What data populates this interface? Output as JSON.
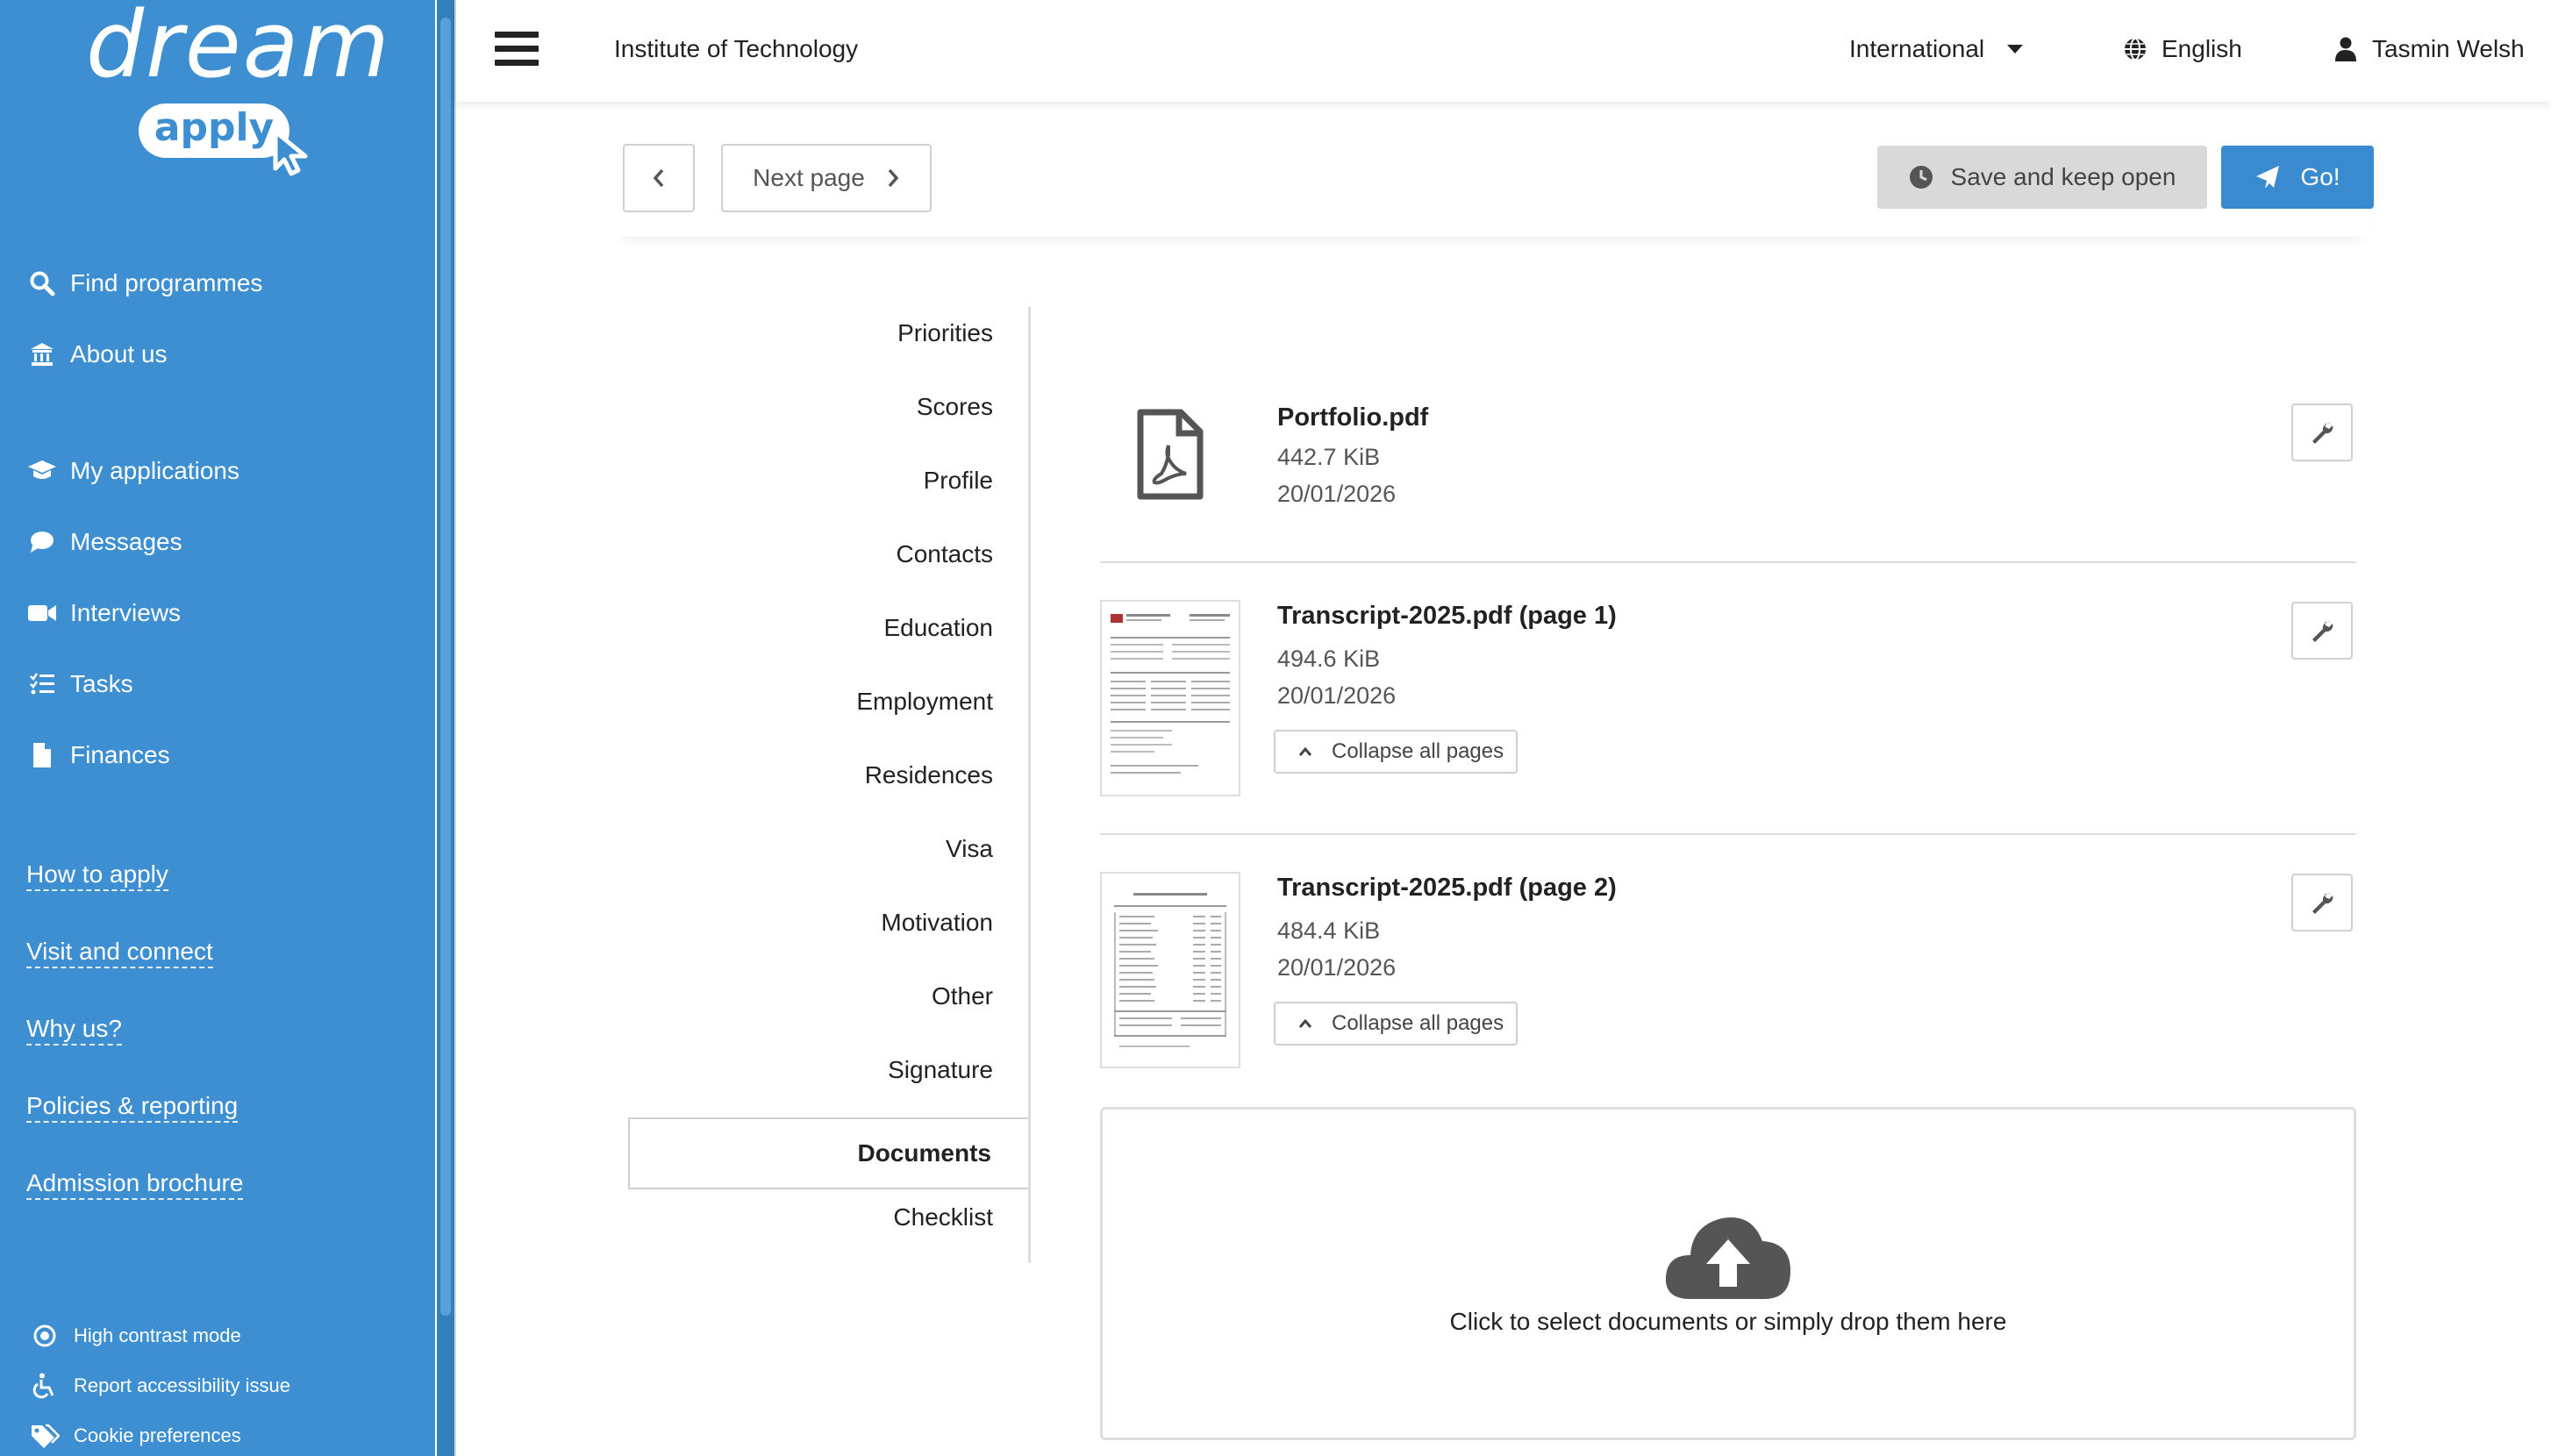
{
  "brand": {
    "logo_word": "dream",
    "logo_badge": "apply"
  },
  "sidebar": {
    "nav": [
      {
        "label": "Find programmes",
        "icon": "search-icon"
      },
      {
        "label": "About us",
        "icon": "institution-icon"
      },
      {
        "label": "My applications",
        "icon": "graduation-cap-icon"
      },
      {
        "label": "Messages",
        "icon": "chat-bubble-icon"
      },
      {
        "label": "Interviews",
        "icon": "video-camera-icon"
      },
      {
        "label": "Tasks",
        "icon": "task-list-icon"
      },
      {
        "label": "Finances",
        "icon": "document-icon"
      }
    ],
    "links": [
      "How to apply",
      "Visit and connect",
      "Why us?",
      "Policies & reporting",
      "Admission brochure"
    ],
    "footer": [
      {
        "label": "High contrast mode",
        "icon": "contrast-icon"
      },
      {
        "label": "Report accessibility issue",
        "icon": "wheelchair-icon"
      },
      {
        "label": "Cookie preferences",
        "icon": "tags-icon"
      }
    ]
  },
  "topbar": {
    "institution": "Institute of Technology",
    "region": "International",
    "language": "English",
    "user": "Tasmin Welsh"
  },
  "actions": {
    "next_page": "Next page",
    "save_keep_open": "Save and keep open",
    "go": "Go!"
  },
  "sections": {
    "items": [
      "Priorities",
      "Scores",
      "Profile",
      "Contacts",
      "Education",
      "Employment",
      "Residences",
      "Visa",
      "Motivation",
      "Other",
      "Signature"
    ],
    "active": "Documents",
    "after": "Checklist"
  },
  "documents": [
    {
      "name": "Portfolio.pdf",
      "size": "442.7 KiB",
      "date": "20/01/2026",
      "type": "pdf-icon"
    },
    {
      "name": "Transcript-2025.pdf (page 1)",
      "size": "494.6 KiB",
      "date": "20/01/2026",
      "collapse": "Collapse all pages"
    },
    {
      "name": "Transcript-2025.pdf (page 2)",
      "size": "484.4 KiB",
      "date": "20/01/2026",
      "collapse": "Collapse all pages"
    }
  ],
  "dropzone": {
    "text": "Click to select documents or simply drop them here"
  },
  "colors": {
    "sidebar": "#3d8fd1",
    "primary_button": "#3a8ad0",
    "secondary_button": "#d9d9d9"
  }
}
